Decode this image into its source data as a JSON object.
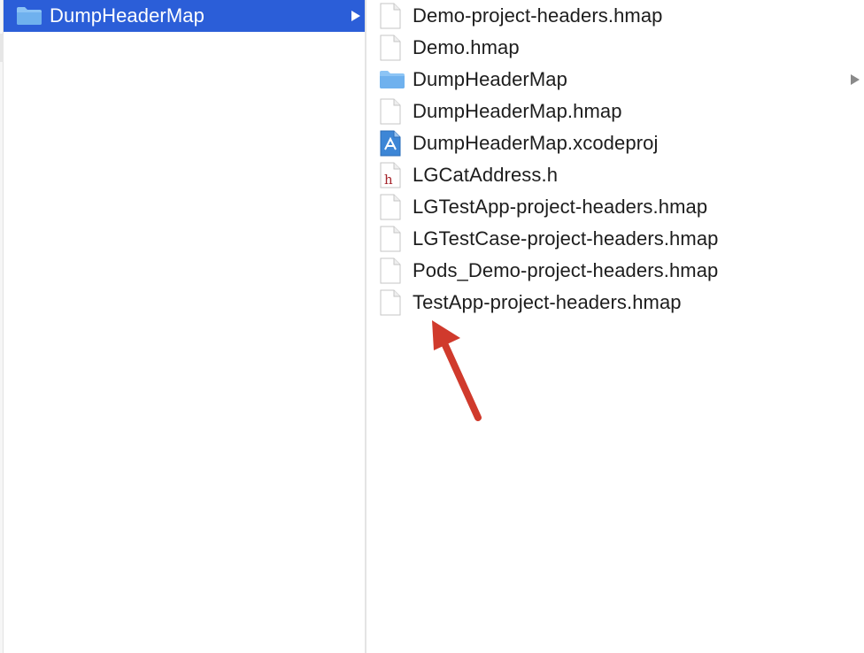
{
  "left_column": {
    "selected_item": {
      "label": "DumpHeaderMap",
      "icon": "folder-icon"
    }
  },
  "right_column": {
    "items": [
      {
        "label": "Demo-project-headers.hmap",
        "icon": "document-icon"
      },
      {
        "label": "Demo.hmap",
        "icon": "document-icon"
      },
      {
        "label": "DumpHeaderMap",
        "icon": "folder-icon"
      },
      {
        "label": "DumpHeaderMap.hmap",
        "icon": "document-icon"
      },
      {
        "label": "DumpHeaderMap.xcodeproj",
        "icon": "xcodeproj-icon"
      },
      {
        "label": "LGCatAddress.h",
        "icon": "header-file-icon"
      },
      {
        "label": "LGTestApp-project-headers.hmap",
        "icon": "document-icon"
      },
      {
        "label": "LGTestCase-project-headers.hmap",
        "icon": "document-icon"
      },
      {
        "label": "Pods_Demo-project-headers.hmap",
        "icon": "document-icon"
      },
      {
        "label": "TestApp-project-headers.hmap",
        "icon": "document-icon"
      }
    ]
  },
  "annotation": {
    "icon": "red-arrow-icon",
    "color": "#d03a2c"
  },
  "colors": {
    "selection": "#2b5ed8",
    "folder": "#76b6f0",
    "text": "#1d1d1d"
  }
}
